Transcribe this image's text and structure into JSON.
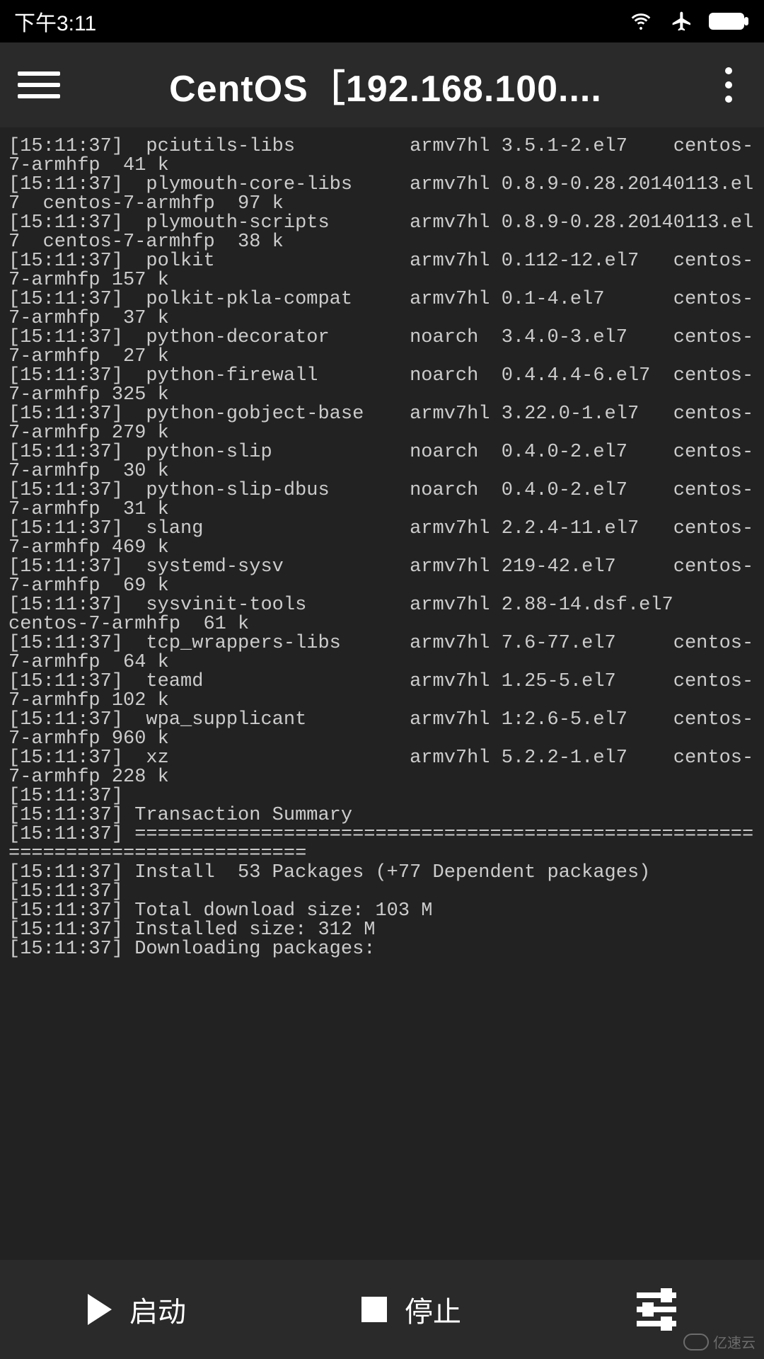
{
  "statusbar": {
    "time": "下午3:11"
  },
  "appbar": {
    "title": "CentOS［192.168.100...."
  },
  "terminal_lines": [
    "[15:11:37]  pciutils-libs          armv7hl 3.5.1-2.el7    centos-7-armhfp  41 k",
    "[15:11:37]  plymouth-core-libs     armv7hl 0.8.9-0.28.20140113.el7  centos-7-armhfp  97 k",
    "[15:11:37]  plymouth-scripts       armv7hl 0.8.9-0.28.20140113.el7  centos-7-armhfp  38 k",
    "[15:11:37]  polkit                 armv7hl 0.112-12.el7   centos-7-armhfp 157 k",
    "[15:11:37]  polkit-pkla-compat     armv7hl 0.1-4.el7      centos-7-armhfp  37 k",
    "[15:11:37]  python-decorator       noarch  3.4.0-3.el7    centos-7-armhfp  27 k",
    "[15:11:37]  python-firewall        noarch  0.4.4.4-6.el7  centos-7-armhfp 325 k",
    "[15:11:37]  python-gobject-base    armv7hl 3.22.0-1.el7   centos-7-armhfp 279 k",
    "[15:11:37]  python-slip            noarch  0.4.0-2.el7    centos-7-armhfp  30 k",
    "[15:11:37]  python-slip-dbus       noarch  0.4.0-2.el7    centos-7-armhfp  31 k",
    "[15:11:37]  slang                  armv7hl 2.2.4-11.el7   centos-7-armhfp 469 k",
    "[15:11:37]  systemd-sysv           armv7hl 219-42.el7     centos-7-armhfp  69 k",
    "[15:11:37]  sysvinit-tools         armv7hl 2.88-14.dsf.el7        centos-7-armhfp  61 k",
    "[15:11:37]  tcp_wrappers-libs      armv7hl 7.6-77.el7     centos-7-armhfp  64 k",
    "[15:11:37]  teamd                  armv7hl 1.25-5.el7     centos-7-armhfp 102 k",
    "[15:11:37]  wpa_supplicant         armv7hl 1:2.6-5.el7    centos-7-armhfp 960 k",
    "[15:11:37]  xz                     armv7hl 5.2.2-1.el7    centos-7-armhfp 228 k",
    "[15:11:37]",
    "[15:11:37] Transaction Summary",
    "[15:11:37] ================================================================================",
    "[15:11:37] Install  53 Packages (+77 Dependent packages)",
    "[15:11:37]",
    "[15:11:37] Total download size: 103 M",
    "[15:11:37] Installed size: 312 M",
    "[15:11:37] Downloading packages:"
  ],
  "bottombar": {
    "start": "启动",
    "stop": "停止"
  },
  "watermark": "亿速云"
}
